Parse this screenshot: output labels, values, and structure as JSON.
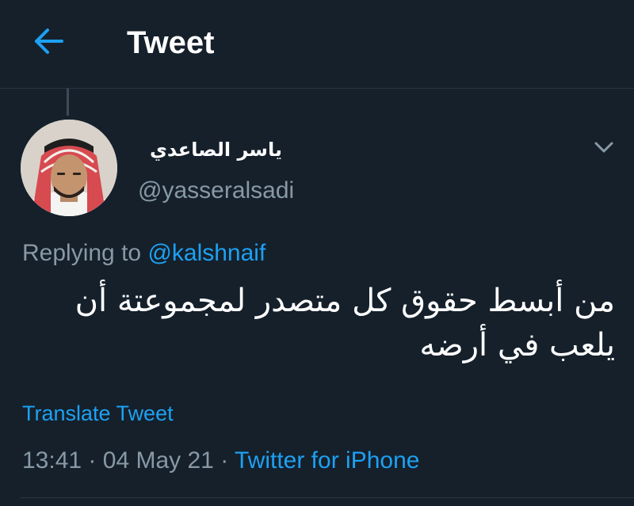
{
  "header": {
    "back_icon": "arrow-left-icon",
    "title": "Tweet"
  },
  "tweet": {
    "author": {
      "display_name": "ياسر الصاعدي",
      "handle": "@yasseralsadi"
    },
    "replying_prefix": "Replying to",
    "replying_to": "@kalshnaif",
    "text": "من أبسط حقوق كل متصدر لمجموعتة أن يلعب في أرضه",
    "translate_label": "Translate Tweet",
    "time": "13:41",
    "separator": "·",
    "date": "04 May 21",
    "source": "Twitter for iPhone",
    "more_icon": "chevron-down-icon"
  },
  "colors": {
    "background": "#15202b",
    "accent": "#1da1f2",
    "secondary_text": "#8899a6",
    "divider": "#2a3642"
  }
}
